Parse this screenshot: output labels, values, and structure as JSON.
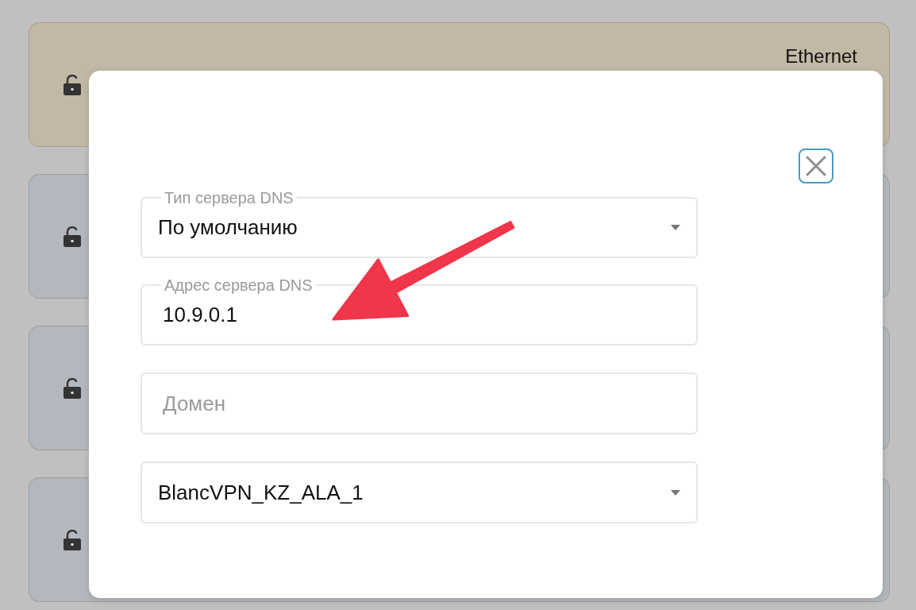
{
  "cards": [
    {
      "title": "Ethernet",
      "color": "#c1b9a5"
    },
    {
      "color": "#b2b8bd"
    },
    {
      "color": "#b2b8bd"
    },
    {
      "color": "#b2b8bd"
    }
  ],
  "dialog": {
    "fields": [
      {
        "kind": "select",
        "label": "Тип сервера DNS",
        "value": "По умолчанию"
      },
      {
        "kind": "input",
        "label": "Адрес сервера DNS",
        "value": "10.9.0.1"
      },
      {
        "kind": "input",
        "placeholder": "Домен"
      },
      {
        "kind": "select",
        "value": "BlancVPN_KZ_ALA_1"
      }
    ]
  }
}
